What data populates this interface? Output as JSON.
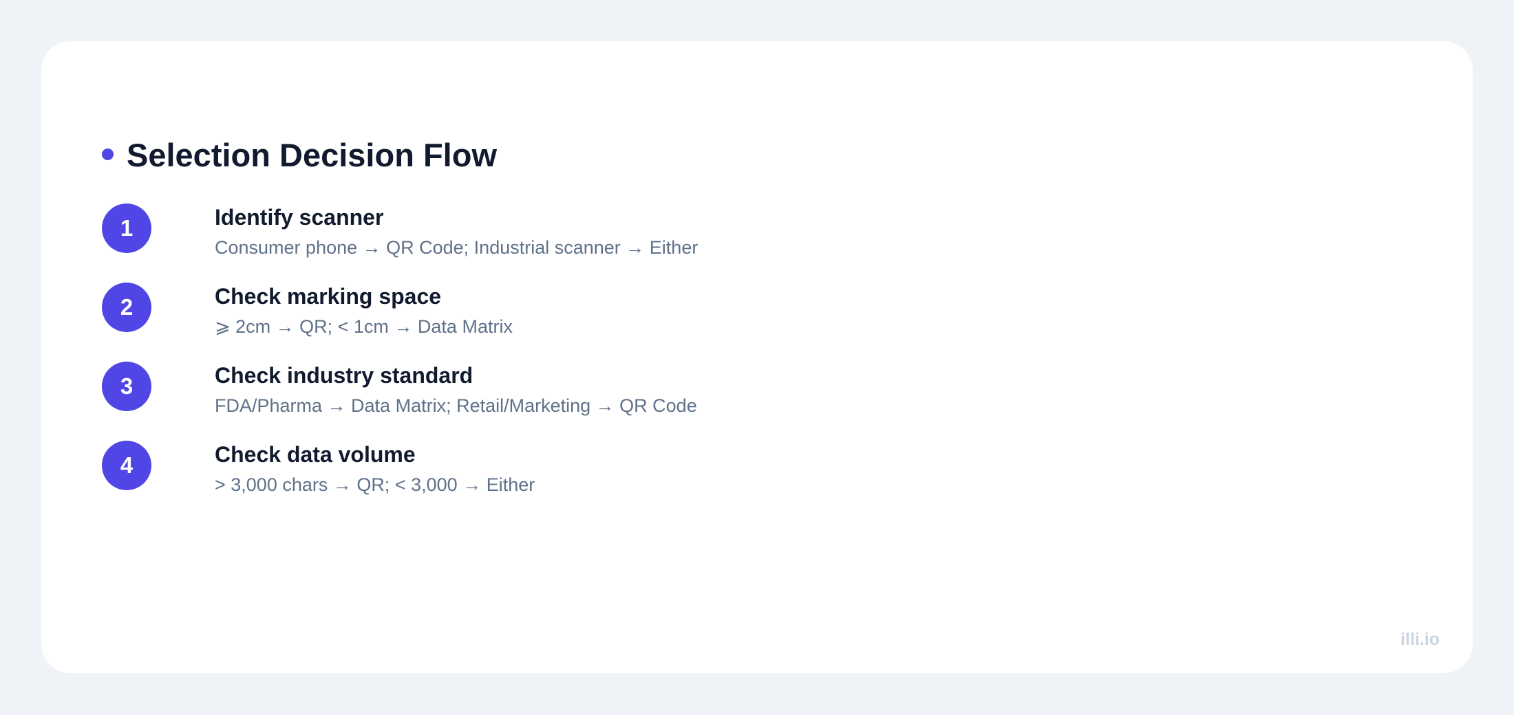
{
  "colors": {
    "accent": "#4f46e5",
    "background": "#eff2f6",
    "card": "#ffffff",
    "title_text": "#111a2e",
    "desc_text": "#5f7189",
    "brand_text": "#cbd5e1"
  },
  "title": "Selection Decision Flow",
  "steps": [
    {
      "number": "1",
      "title": "Identify scanner",
      "description": "Consumer phone → QR Code; Industrial scanner → Either"
    },
    {
      "number": "2",
      "title": "Check marking space",
      "description": "⩾ 2cm → QR; < 1cm → Data Matrix"
    },
    {
      "number": "3",
      "title": "Check industry standard",
      "description": "FDA/Pharma → Data Matrix; Retail/Marketing → QR Code"
    },
    {
      "number": "4",
      "title": "Check data volume",
      "description": "> 3,000 chars → QR; < 3,000 → Either"
    }
  ],
  "brand": "illi.io"
}
